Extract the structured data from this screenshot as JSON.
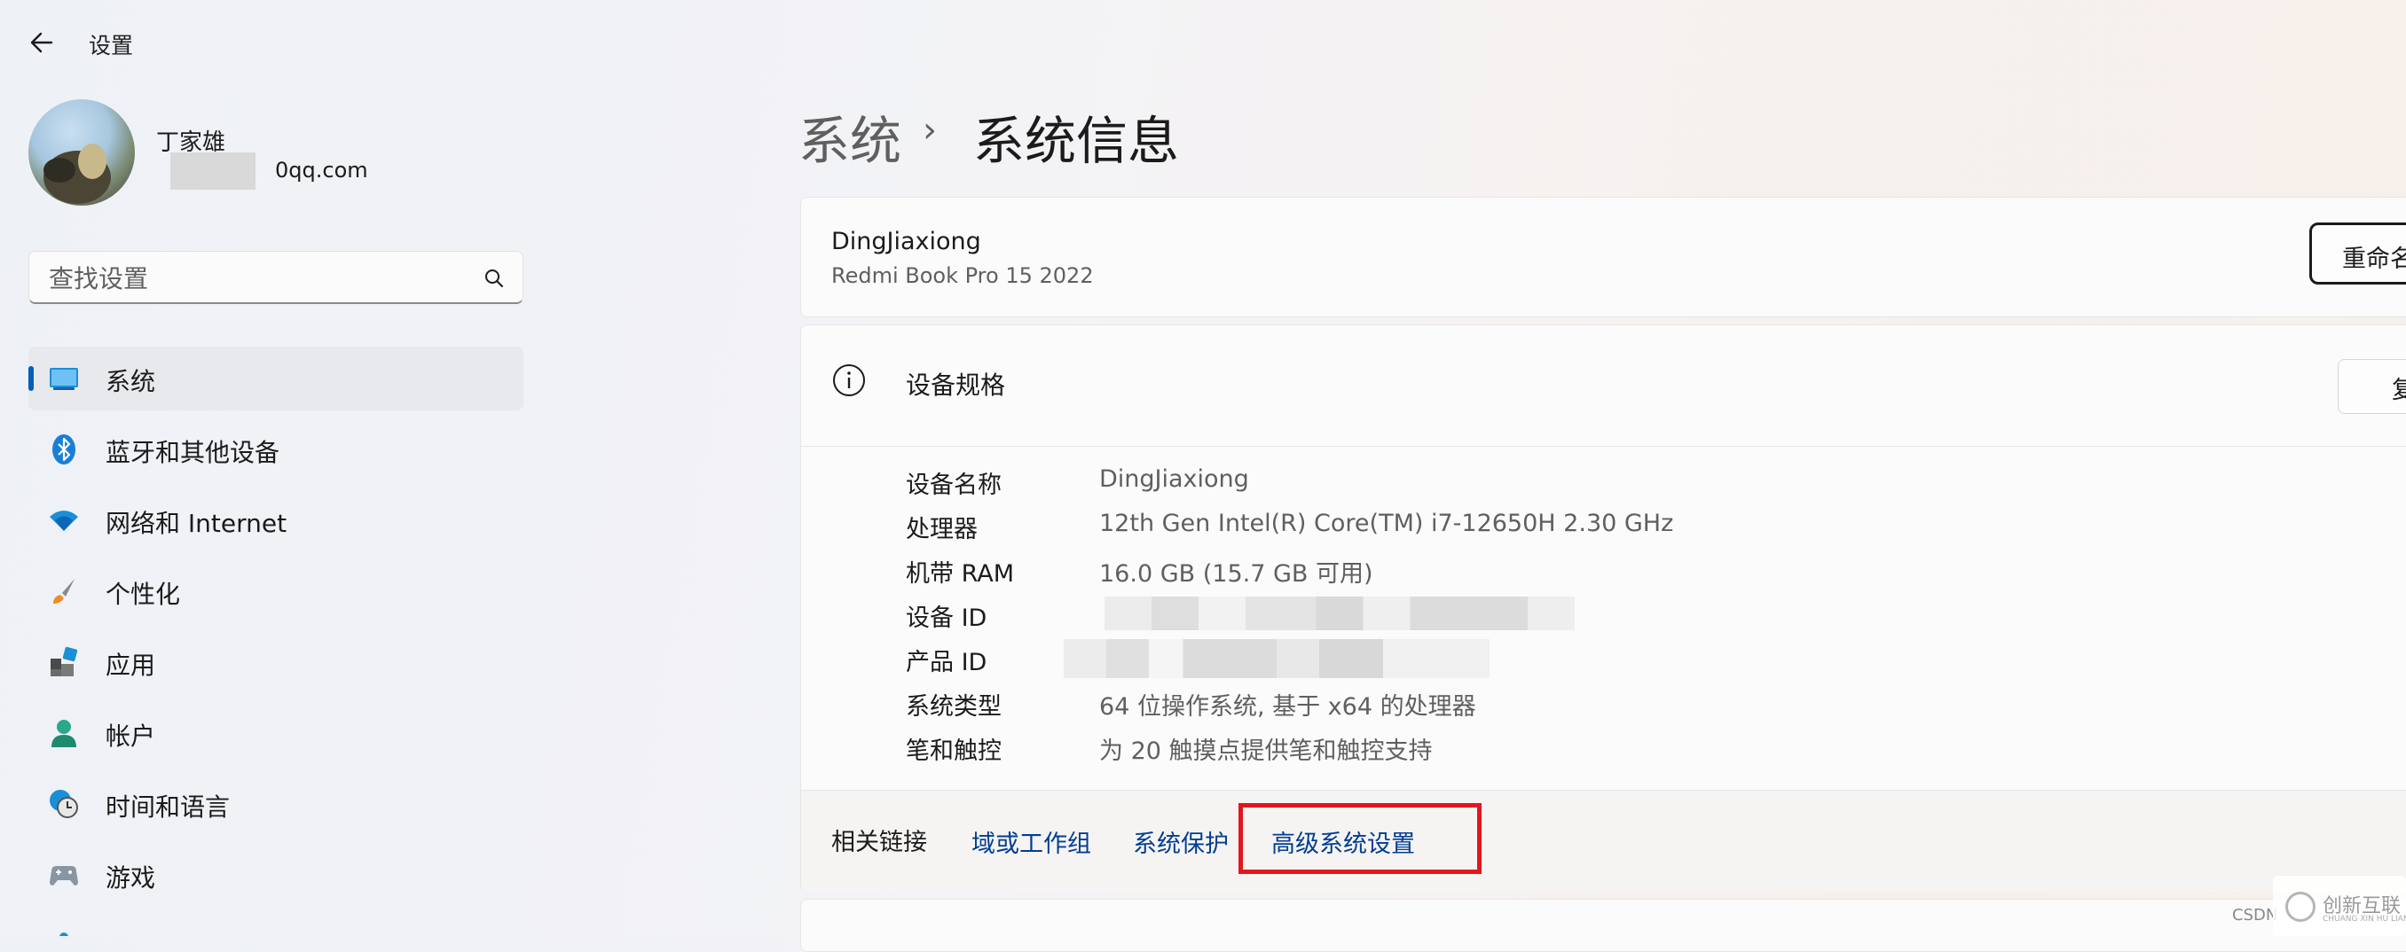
{
  "window": {
    "title": "设置"
  },
  "profile": {
    "name": "丁家雄",
    "email_suffix": "qq.com",
    "email_visible": "0qq.com"
  },
  "search": {
    "placeholder": "查找设置"
  },
  "sidebar": {
    "items": [
      {
        "label": "系统",
        "icon": "system-monitor-icon",
        "active": true
      },
      {
        "label": "蓝牙和其他设备",
        "icon": "bluetooth-icon"
      },
      {
        "label": "网络和 Internet",
        "icon": "wifi-icon"
      },
      {
        "label": "个性化",
        "icon": "brush-icon"
      },
      {
        "label": "应用",
        "icon": "apps-icon"
      },
      {
        "label": "帐户",
        "icon": "account-icon"
      },
      {
        "label": "时间和语言",
        "icon": "clock-globe-icon"
      },
      {
        "label": "游戏",
        "icon": "gamepad-icon"
      }
    ]
  },
  "breadcrumb": {
    "parent": "系统",
    "separator": "›",
    "current": "系统信息"
  },
  "device": {
    "name": "DingJiaxiong",
    "model": "Redmi Book Pro 15 2022",
    "rename_label": "重命名"
  },
  "specs": {
    "title": "设备规格",
    "copy_label": "复制",
    "rows": [
      {
        "label": "设备名称",
        "value": "DingJiaxiong"
      },
      {
        "label": "处理器",
        "value": "12th Gen Intel(R) Core(TM) i7-12650H   2.30 GHz"
      },
      {
        "label": "机带 RAM",
        "value": "16.0 GB (15.7 GB 可用)"
      },
      {
        "label": "设备 ID",
        "value": ""
      },
      {
        "label": "产品 ID",
        "value": ""
      },
      {
        "label": "系统类型",
        "value": "64 位操作系统, 基于 x64 的处理器"
      },
      {
        "label": "笔和触控",
        "value": "为 20 触摸点提供笔和触控支持"
      }
    ]
  },
  "related": {
    "label": "相关链接",
    "links": [
      "域或工作组",
      "系统保护",
      "高级系统设置"
    ]
  },
  "footer": {
    "csdn": "CSDN",
    "watermark": "创新互联",
    "watermark_sub": "CHUANG XIN HU LIAN"
  },
  "colors": {
    "accent": "#005fb8",
    "link": "#003e92",
    "highlight": "#e3161f"
  }
}
